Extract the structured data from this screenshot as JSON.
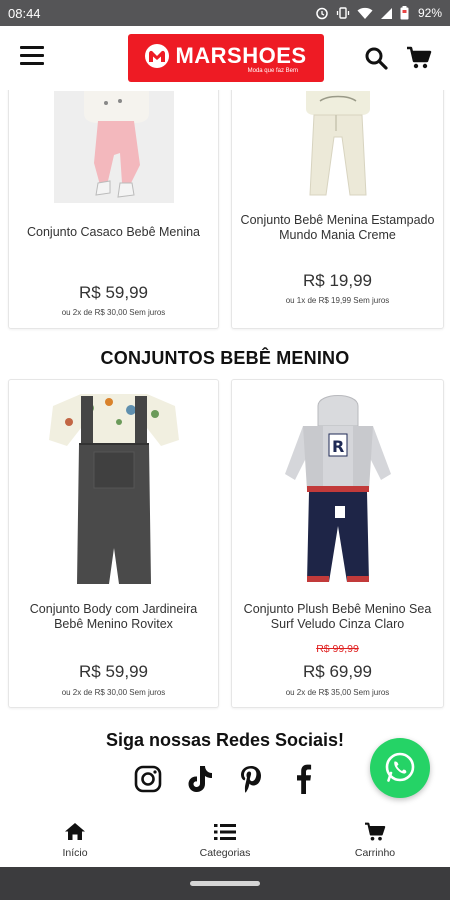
{
  "status_bar": {
    "time": "08:44",
    "battery": "92%"
  },
  "header": {
    "logo_text": "MARSHOES",
    "logo_tagline": "Moda que faz Bem",
    "brand_color": "#ee1b24"
  },
  "products_top": [
    {
      "name": "Conjunto Casaco Bebê Menina",
      "price": "R$ 59,99",
      "installments": "ou 2x de R$ 30,00 Sem juros"
    },
    {
      "name": "Conjunto Bebê Menina Estampado Mundo Mania Creme",
      "price": "R$ 19,99",
      "installments": "ou 1x de R$ 19,99 Sem juros"
    }
  ],
  "section": {
    "title": "CONJUNTOS BEBÊ MENINO"
  },
  "products_boy": [
    {
      "name": "Conjunto Body com Jardineira Bebê Menino Rovitex",
      "price": "R$ 59,99",
      "installments": "ou 2x de R$ 30,00 Sem juros"
    },
    {
      "name": "Conjunto Plush Bebê Menino Sea Surf Veludo Cinza Claro",
      "old_price": "R$ 99,99",
      "price": "R$ 69,99",
      "installments": "ou 2x de R$ 35,00 Sem juros"
    }
  ],
  "social": {
    "title": "Siga nossas Redes Sociais!",
    "icons": [
      "instagram-icon",
      "tiktok-icon",
      "pinterest-icon",
      "facebook-icon"
    ]
  },
  "bottom_nav": [
    {
      "label": "Início",
      "icon": "home-icon"
    },
    {
      "label": "Categorias",
      "icon": "list-icon"
    },
    {
      "label": "Carrinho",
      "icon": "cart-icon"
    }
  ]
}
